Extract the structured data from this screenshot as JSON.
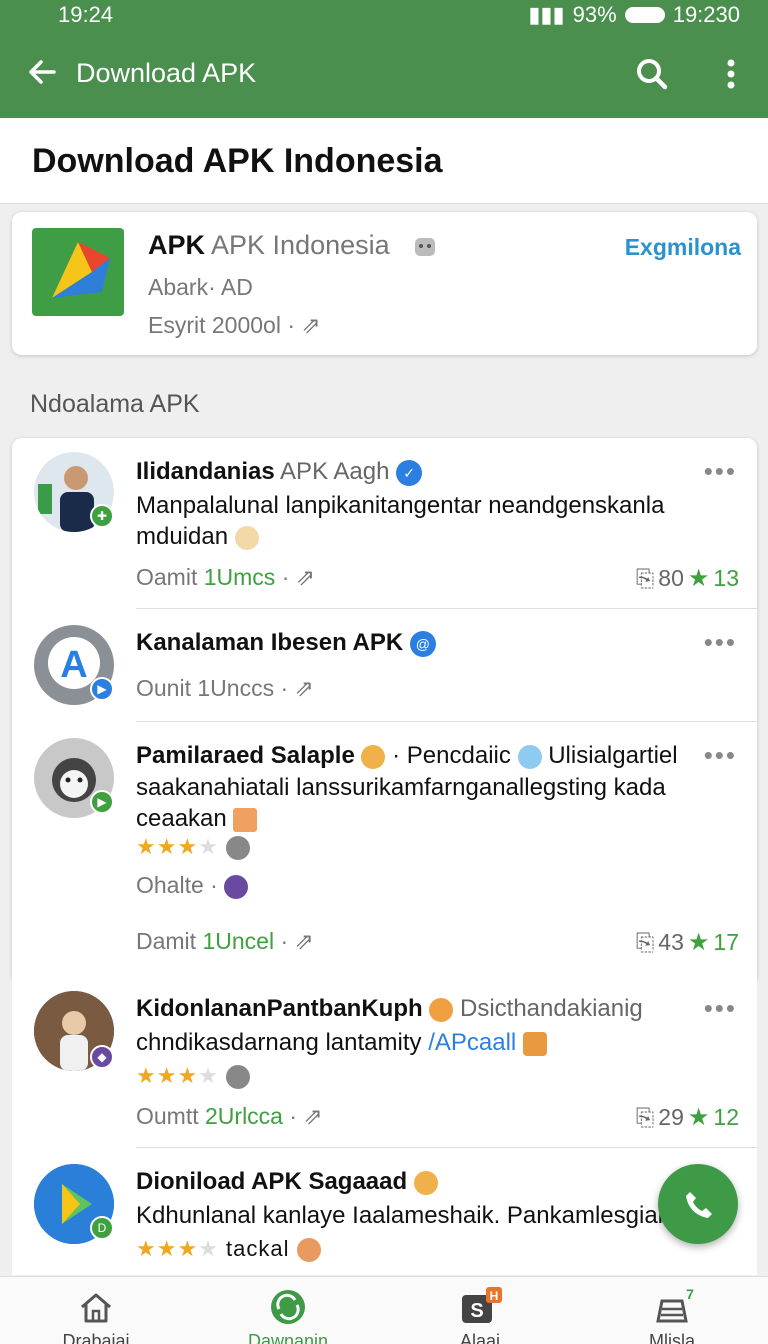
{
  "status_bar": {
    "time_left": "19:24",
    "battery": "93%",
    "time_right": "19:230"
  },
  "app_bar": {
    "title": "Download APK"
  },
  "page_title": "Download APK Indonesia",
  "featured": {
    "name_bold": "APK",
    "name_light": "APK Indonesia",
    "subtitle": "Abark· AD",
    "meta": "Esyrit 2000ol ·",
    "action": "Exgmilona"
  },
  "section_label": "Ndoalama APK",
  "items": [
    {
      "name": "Ilidandanias",
      "name_light": "APK Aagh",
      "text": "Manpalalunal lanpikanitangentar neandgenskanla mduidan",
      "meta_prefix": "Oamit",
      "meta_value": "1Umcs",
      "share_count": "80",
      "stars": "13"
    },
    {
      "name": "Kanalaman Ibesen APK",
      "meta_prefix": "Ounit",
      "meta_value": "1Unccs"
    },
    {
      "name": "Pamilaraed Salaple",
      "name_light": "· Pencdaiic",
      "name_extra": "Ulisialgartiel",
      "text": "saakanahiatali lanssurikamfarnganallegsting kada ceaakan",
      "rating_stars": "★★★",
      "meta_line": "Ohalte ·",
      "meta_prefix": "Damit",
      "meta_value": "1Uncel",
      "share_count": "43",
      "stars": "17"
    },
    {
      "name": "KidonlananPantbanKuph",
      "name_light": "Dsicthandakianig",
      "text": "chndikasdarnang lantamity",
      "text_link": "/APcaall",
      "rating_stars": "★★★",
      "meta_prefix": "Oumtt",
      "meta_value": "2Urlcca",
      "share_count": "29",
      "stars": "12"
    },
    {
      "name": "Dioniload APK Sagaaad",
      "text": "Kdhunlanal kanlaye Iaalameshaik. Pankamlesgian",
      "rating_stars": "★★★",
      "rating_text": "tackal"
    }
  ],
  "bottom_nav": [
    {
      "label": "Drabaiai"
    },
    {
      "label": "Dawnanin"
    },
    {
      "label": "Alaai",
      "badge": "H"
    },
    {
      "label": "Mlisla",
      "badge": "7"
    }
  ],
  "colors": {
    "primary": "#4a8f4e",
    "accent_green": "#3fa03f",
    "link_blue": "#2a92d0"
  }
}
